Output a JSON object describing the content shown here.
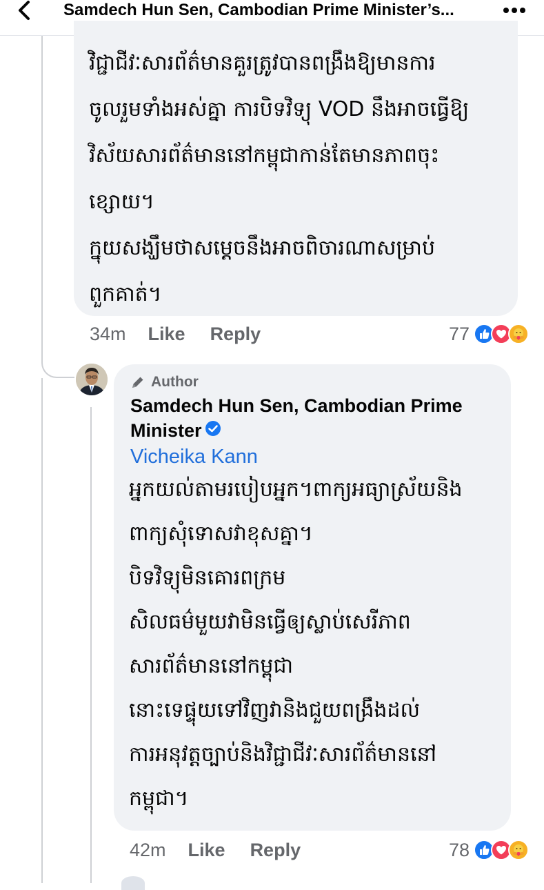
{
  "header": {
    "title": "Samdech Hun Sen, Cambodian Prime Minister’s...",
    "back_icon": "chevron-left-icon",
    "more_icon": "more-horizontal-icon"
  },
  "comment1": {
    "lines": [
      "វិជ្ជាជីវៈសារព័ត៌មានគួរត្រូវបានពង្រឹងឱ្យមានការ",
      "ចូលរួមទាំងអស់គ្នា ការបិទវិទ្យុ VOD នឹងអាចធ្វើឱ្យ",
      "វិស័យសារព័ត៌មាននៅកម្ពុជាកាន់តែមានភាពចុះ",
      "ខ្សោយ។",
      "ក្នុយសង្ឃឹមថាសម្តេចនឹងអាចពិចារណាសម្រាប់",
      "ពួកគាត់។"
    ],
    "time": "34m",
    "like_label": "Like",
    "reply_label": "Reply",
    "reaction_count": "77",
    "reactions": [
      "like-reaction-icon",
      "love-reaction-icon",
      "care-reaction-icon"
    ]
  },
  "comment2": {
    "author_badge": "Author",
    "commenter": "Samdech Hun Sen, Cambodian Prime Minister",
    "verified_icon": "verified-badge-icon",
    "mention": "Vicheika Kann",
    "lines": [
      "អ្នកយល់តាមរបៀបអ្នក។ពាក្យអធ្យាស្រ័យនិង",
      "ពាក្យសុំទោសវាខុសគ្នា។",
      "បិទវិទ្យុមិនគោរពក្រម",
      "សិលធម៌មួយវាមិនធ្វើឲ្យស្លាប់សេរីភាព",
      "សារព័ត៌មាននៅកម្ពុជា",
      "នោះទេផ្ទុយទៅវិញវានិងជួយពង្រឹងដល់",
      "ការអនុវត្តច្បាប់និងវិជ្ជាជីវៈសារព័ត៌មាននៅ",
      "កម្ពុជា។"
    ],
    "time": "42m",
    "like_label": "Like",
    "reply_label": "Reply",
    "reaction_count": "78",
    "reactions": [
      "like-reaction-icon",
      "love-reaction-icon",
      "care-reaction-icon"
    ]
  },
  "colors": {
    "bubble": "#f0f2f5",
    "link": "#216fdb",
    "secondary_text": "#65676b",
    "like_blue": "#1877f2",
    "love_red": "#f33e58",
    "care_yellow": "#f7b125"
  }
}
